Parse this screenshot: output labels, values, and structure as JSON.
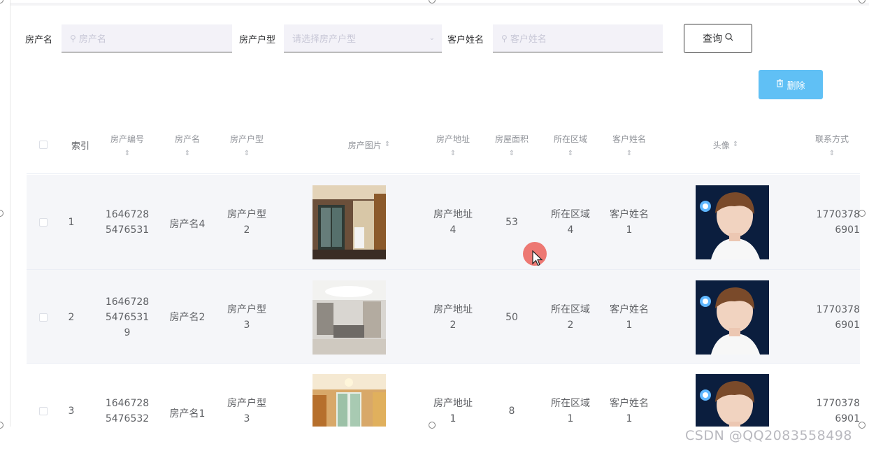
{
  "search": {
    "house_name_label": "房产名",
    "house_name_placeholder": "房产名",
    "house_type_label": "房产户型",
    "house_type_placeholder": "请选择房产户型",
    "customer_name_label": "客户姓名",
    "customer_name_placeholder": "客户姓名",
    "query_label": "查询"
  },
  "toolbar": {
    "delete_label": "删除"
  },
  "table": {
    "headers": {
      "index": "索引",
      "house_no": "房产编号",
      "house_name": "房产名",
      "house_type": "房产户型",
      "house_image": "房产图片",
      "address": "房产地址",
      "area": "房屋面积",
      "region": "所在区域",
      "customer": "客户姓名",
      "avatar": "头像",
      "contact": "联系方式"
    },
    "rows": [
      {
        "index": "1",
        "house_no_1": "1646728",
        "house_no_2": "5476531",
        "house_no_3": "",
        "house_name": "房产名4",
        "type_1": "房产户型",
        "type_2": "2",
        "addr_1": "房产地址",
        "addr_2": "4",
        "area": "53",
        "region_1": "所在区域",
        "region_2": "4",
        "cust_1": "客户姓名",
        "cust_2": "1",
        "contact_1": "1770378",
        "contact_2": "6901"
      },
      {
        "index": "2",
        "house_no_1": "1646728",
        "house_no_2": "5476531",
        "house_no_3": "9",
        "house_name": "房产名2",
        "type_1": "房产户型",
        "type_2": "3",
        "addr_1": "房产地址",
        "addr_2": "2",
        "area": "50",
        "region_1": "所在区域",
        "region_2": "2",
        "cust_1": "客户姓名",
        "cust_2": "1",
        "contact_1": "1770378",
        "contact_2": "6901"
      },
      {
        "index": "3",
        "house_no_1": "1646728",
        "house_no_2": "5476532",
        "house_no_3": "",
        "house_name": "房产名1",
        "type_1": "房产户型",
        "type_2": "3",
        "addr_1": "房产地址",
        "addr_2": "1",
        "area": "8",
        "region_1": "所在区域",
        "region_2": "1",
        "cust_1": "客户姓名",
        "cust_2": "1",
        "contact_1": "1770378",
        "contact_2": "6901"
      }
    ]
  },
  "icons": {
    "search": "search-icon",
    "chevron": "chevron-down-icon",
    "sort": "sort-caret-icon",
    "delete": "trash-icon"
  },
  "colors": {
    "delete_button": "#60c0f5",
    "input_bg": "#f3f2f8",
    "stripe": "#f5f6f9",
    "cursor_highlight": "#ec6a64"
  },
  "watermark": "CSDN @QQ2083558498"
}
